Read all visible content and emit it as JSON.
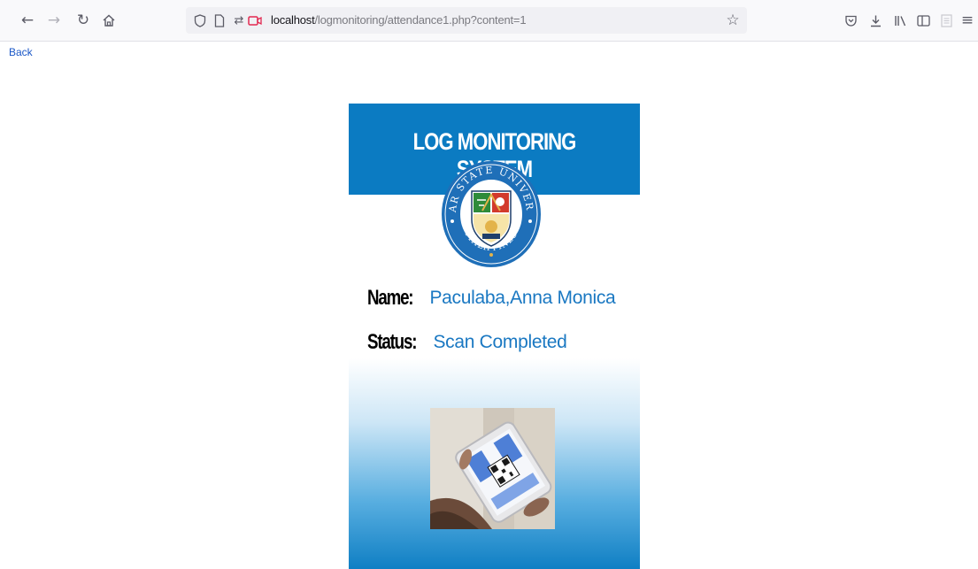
{
  "browser": {
    "url_host": "localhost",
    "url_path": "/logmonitoring/attendance1.php?content=1"
  },
  "page": {
    "back_label": "Back"
  },
  "card": {
    "title": "LOG MONITORING SYSTEM",
    "seal": {
      "top_text": "SAMAR STATE UNIVERSITY",
      "bottom_text": "PHILIPPINES",
      "colors": {
        "ring": "#1f6fb8",
        "green": "#2e8b3a",
        "red": "#d23a2c",
        "gold": "#e3b34a"
      }
    },
    "name_label": "Name:",
    "name_value": "Paculaba,Anna Monica",
    "status_label": "Status:",
    "status_value": "Scan Completed",
    "header_color": "#0b7bc2"
  }
}
